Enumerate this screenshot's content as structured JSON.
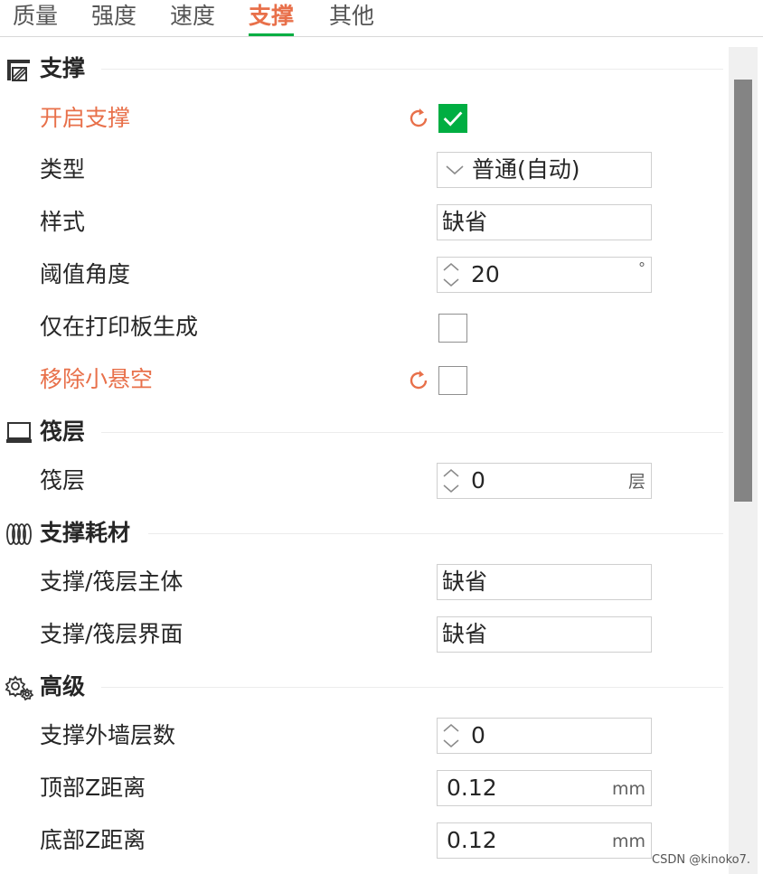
{
  "tabs": [
    "质量",
    "强度",
    "速度",
    "支撑",
    "其他"
  ],
  "active_tab": "支撑",
  "sections": {
    "support": {
      "title": "支撑",
      "icon": "support-icon",
      "enable_support": {
        "label": "开启支撑",
        "checked": true
      },
      "type": {
        "label": "类型",
        "value": "普通(自动)"
      },
      "style": {
        "label": "样式",
        "value": "缺省"
      },
      "threshold": {
        "label": "阈值角度",
        "value": "20",
        "unit": "°"
      },
      "on_build_plate_only": {
        "label": "仅在打印板生成",
        "checked": false
      },
      "remove_small_overhang": {
        "label": "移除小悬空",
        "checked": false
      }
    },
    "raft": {
      "title": "筏层",
      "icon": "raft-icon",
      "raft_layers": {
        "label": "筏层",
        "value": "0",
        "unit": "层"
      }
    },
    "filament": {
      "title": "支撑耗材",
      "icon": "filament-icon",
      "base": {
        "label": "支撑/筏层主体",
        "value": "缺省"
      },
      "interface": {
        "label": "支撑/筏层界面",
        "value": "缺省"
      }
    },
    "advanced": {
      "title": "高级",
      "icon": "gear-icon",
      "wall_loops": {
        "label": "支撑外墙层数",
        "value": "0"
      },
      "top_z": {
        "label": "顶部Z距离",
        "value": "0.12",
        "unit": "mm"
      },
      "bottom_z": {
        "label": "底部Z距离",
        "value": "0.12",
        "unit": "mm"
      }
    }
  },
  "colors": {
    "accent": "#e8704a",
    "checkbox": "#00ae42",
    "tab_underline": "#00ae42"
  },
  "watermark": "CSDN @kinoko7."
}
